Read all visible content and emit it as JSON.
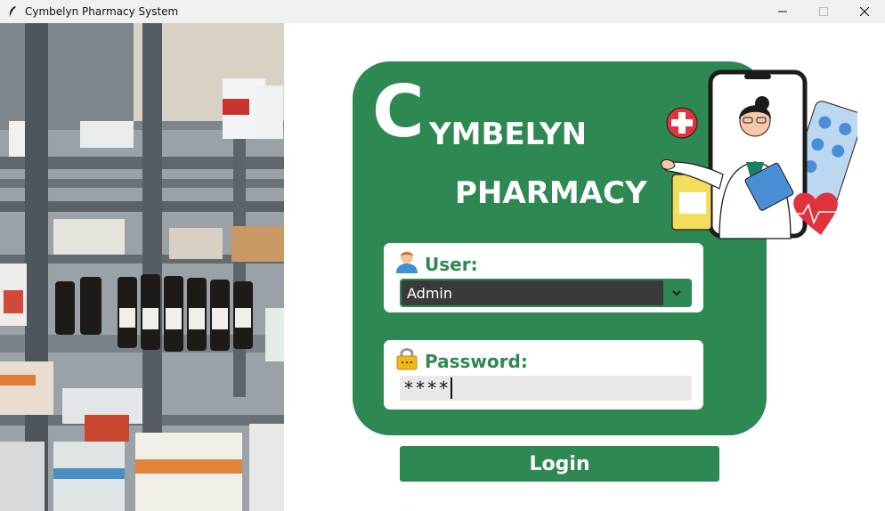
{
  "window": {
    "title": "Cymbelyn Pharmacy System"
  },
  "brand": {
    "initial": "C",
    "rest": "YMBELYN",
    "subtitle": "PHARMACY"
  },
  "user_field": {
    "label": "User:",
    "selected": "Admin",
    "icon": "user-avatar-icon"
  },
  "password_field": {
    "label": "Password:",
    "value": "****",
    "icon": "padlock-icon"
  },
  "login": {
    "label": "Login"
  },
  "colors": {
    "accent": "#2e8852",
    "select_bg": "#3a3a3a",
    "input_bg": "#e9e9e9"
  }
}
